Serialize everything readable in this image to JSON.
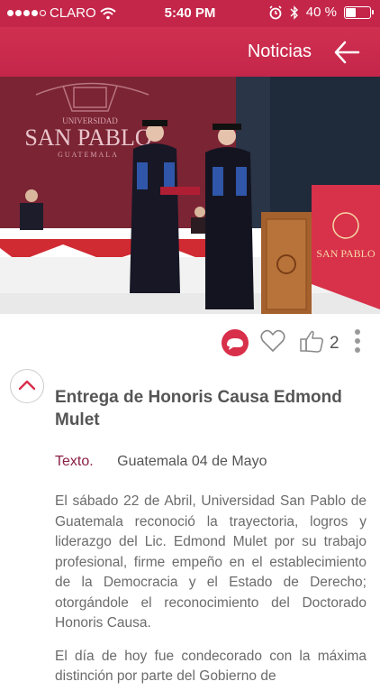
{
  "status_bar": {
    "carrier": "CLARO",
    "time": "5:40 PM",
    "battery": "40 %"
  },
  "header": {
    "title": "Noticias"
  },
  "hero_image": {
    "banner_text": "SAN PABLO",
    "banner_sub": "UNIVERSIDAD",
    "banner_city": "GUATEMALA",
    "flag_text": "SAN PABLO"
  },
  "actions": {
    "like_count": "2"
  },
  "article": {
    "title": "Entrega de Honoris Causa Edmond Mulet",
    "label": "Texto.",
    "place_date": "Guatemala 04 de Mayo",
    "paragraphs": [
      "El sábado 22 de Abril, Universidad San Pablo de Guatemala reconoció la trayectoria, logros y liderazgo del Lic. Edmond Mulet por su trabajo profesional, firme empeño en el establecimiento de la Democracia y el Estado de Derecho; otorgándole el reconocimiento del Doctorado Honoris Causa.",
      "El día de hoy fue condecorado con la máxima distinción por parte del Gobierno de"
    ]
  },
  "colors": {
    "brand": "#c4264a",
    "accent_label": "#8a1f44"
  }
}
